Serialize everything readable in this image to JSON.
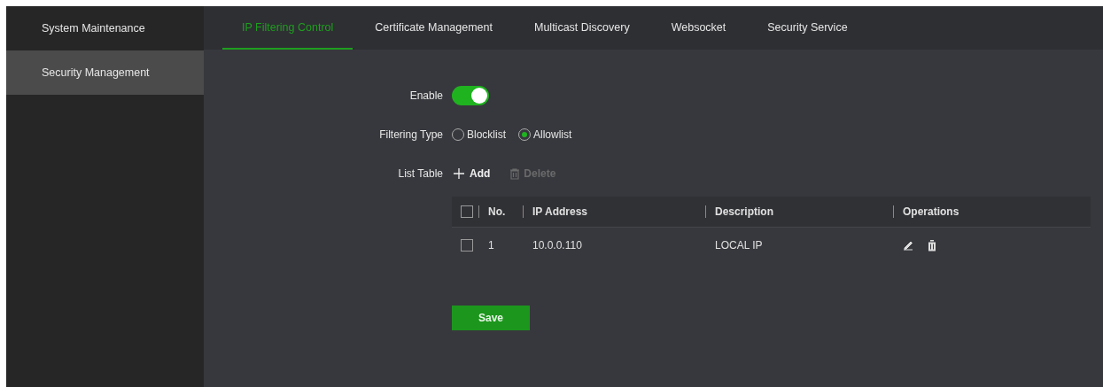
{
  "sidebar": {
    "items": [
      {
        "label": "System Maintenance",
        "selected": false
      },
      {
        "label": "Security Management",
        "selected": true
      }
    ]
  },
  "tabs": [
    {
      "label": "IP Filtering Control",
      "selected": true
    },
    {
      "label": "Certificate Management",
      "selected": false
    },
    {
      "label": "Multicast Discovery",
      "selected": false
    },
    {
      "label": "Websocket",
      "selected": false
    },
    {
      "label": "Security Service",
      "selected": false
    }
  ],
  "form": {
    "enable": {
      "label": "Enable",
      "on": true
    },
    "filtering_type": {
      "label": "Filtering Type",
      "options": [
        {
          "label": "Blocklist",
          "selected": false
        },
        {
          "label": "Allowlist",
          "selected": true
        }
      ]
    },
    "list_table": {
      "label": "List Table",
      "add": {
        "label": "Add",
        "disabled": false
      },
      "delete": {
        "label": "Delete",
        "disabled": true
      }
    }
  },
  "table": {
    "all_checked": false,
    "columns": [
      "No.",
      "IP Address",
      "Description",
      "Operations"
    ],
    "rows": [
      {
        "checked": false,
        "no": "1",
        "ip_address": "10.0.0.110",
        "description": "LOCAL IP"
      }
    ]
  },
  "save_button": "Save"
}
